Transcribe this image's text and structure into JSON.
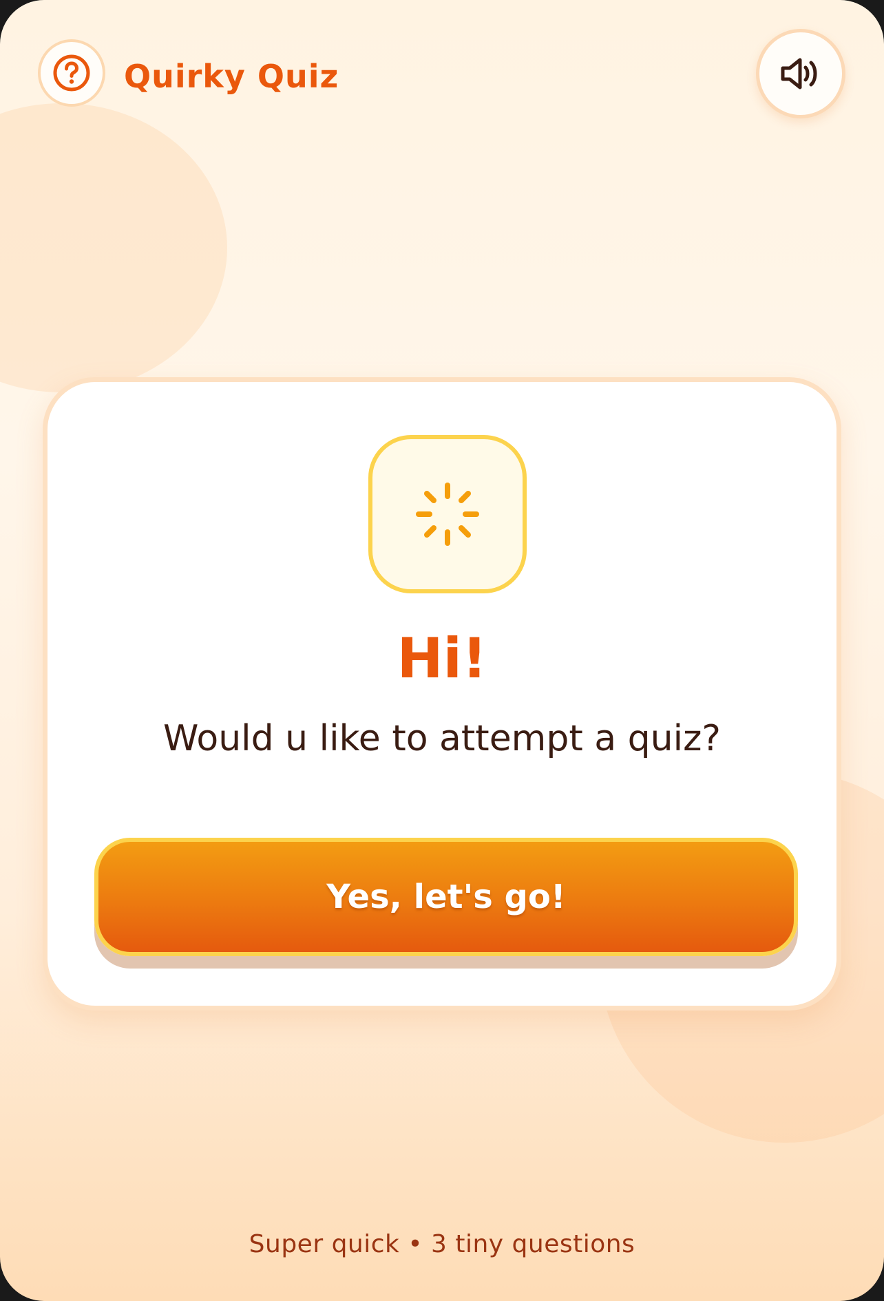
{
  "header": {
    "help_icon": "question-circle-icon",
    "title": "Quirky Quiz",
    "sound_icon": "speaker-volume-icon"
  },
  "card": {
    "icon": "sparkle-burst-icon",
    "greeting": "Hi!",
    "question": "Would u like to attempt a quiz?",
    "start_button_label": "Yes, let's go!"
  },
  "footer": {
    "tagline": "Super quick • 3 tiny questions"
  },
  "colors": {
    "accent": "#ea580c",
    "accent_light": "#f39c12",
    "highlight": "#fcd34d",
    "text_dark": "#3a1c12",
    "footer_text": "#9a3412",
    "background": "#fff3e2"
  }
}
